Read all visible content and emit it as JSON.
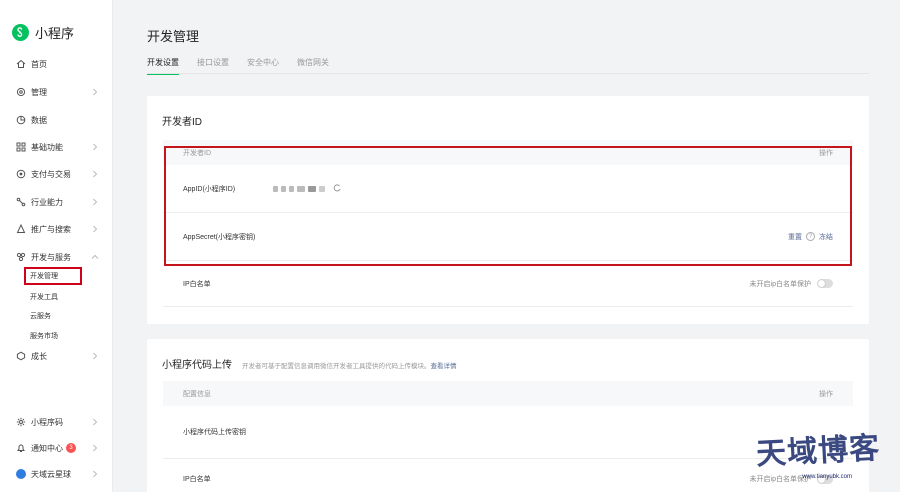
{
  "brand": {
    "title": "小程序"
  },
  "nav": {
    "home": "首页",
    "manage": "管理",
    "data": "数据",
    "basic": "基础功能",
    "pay": "支付与交易",
    "industry": "行业能力",
    "promo": "推广与搜索",
    "dev": "开发与服务",
    "sub": [
      "开发管理",
      "开发工具",
      "云服务",
      "服务市场"
    ],
    "growth": "成长",
    "code": "小程序码",
    "notify": "通知中心",
    "notify_count": "3",
    "user": "天域云星球"
  },
  "page": {
    "title": "开发管理"
  },
  "tabs": [
    "开发设置",
    "接口设置",
    "安全中心",
    "微信网关"
  ],
  "dev_id": {
    "title": "开发者ID",
    "header_col1": "开发者ID",
    "header_col2": "操作",
    "appid_label": "AppID(小程序ID)",
    "secret_label": "AppSecret(小程序密钥)",
    "reset": "重置",
    "freeze": "冻结",
    "qmark": "?",
    "ip_label": "IP白名单",
    "ip_status": "未开启ip白名单保护"
  },
  "upload": {
    "title": "小程序代码上传",
    "desc": "开发者可基于配置信息调用微信开发者工具提供的代码上传模块。",
    "link": "查看详情",
    "header_col1": "配置信息",
    "header_col2": "操作",
    "key_label": "小程序代码上传密钥",
    "ip_label": "IP白名单",
    "ip_status": "未开启ip白名单保护"
  },
  "watermark": {
    "text": "天域博客",
    "sub": "www.tianyubk.com"
  },
  "colors": {
    "accent": "#07c160",
    "highlight": "#c4151c",
    "link": "#576b95"
  }
}
